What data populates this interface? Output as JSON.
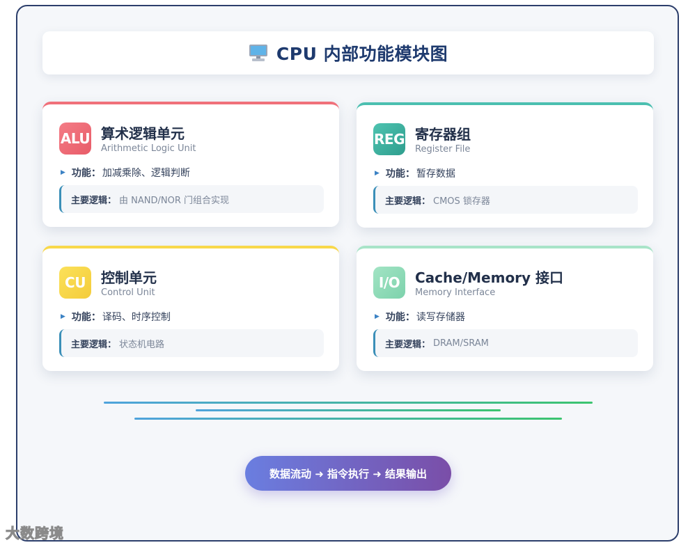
{
  "header": {
    "title": "CPU 内部功能模块图",
    "icon": "desktop-computer-icon"
  },
  "modules": [
    {
      "badge": "ALU",
      "name": "算术逻辑单元",
      "subtitle": "Arithmetic Logic Unit",
      "function_label": "功能：",
      "function_text": "加减乘除、逻辑判断",
      "logic_label": "主要逻辑：",
      "logic_text": "由 NAND/NOR 门组合实现",
      "color": "#f0707a"
    },
    {
      "badge": "REG",
      "name": "寄存器组",
      "subtitle": "Register File",
      "function_label": "功能：",
      "function_text": "暂存数据",
      "logic_label": "主要逻辑：",
      "logic_text": "CMOS 锁存器",
      "color": "#4bbfb0"
    },
    {
      "badge": "CU",
      "name": "控制单元",
      "subtitle": "Control Unit",
      "function_label": "功能：",
      "function_text": "译码、时序控制",
      "logic_label": "主要逻辑：",
      "logic_text": "状态机电路",
      "color": "#f8d84a"
    },
    {
      "badge": "I/O",
      "name": "Cache/Memory 接口",
      "subtitle": "Memory Interface",
      "function_label": "功能：",
      "function_text": "读写存储器",
      "logic_label": "主要逻辑：",
      "logic_text": "DRAM/SRAM",
      "color": "#8fdcb8"
    }
  ],
  "flow": {
    "label": "数据流动 ➜ 指令执行 ➜ 结果输出"
  },
  "watermark": {
    "text": "大数跨境"
  }
}
